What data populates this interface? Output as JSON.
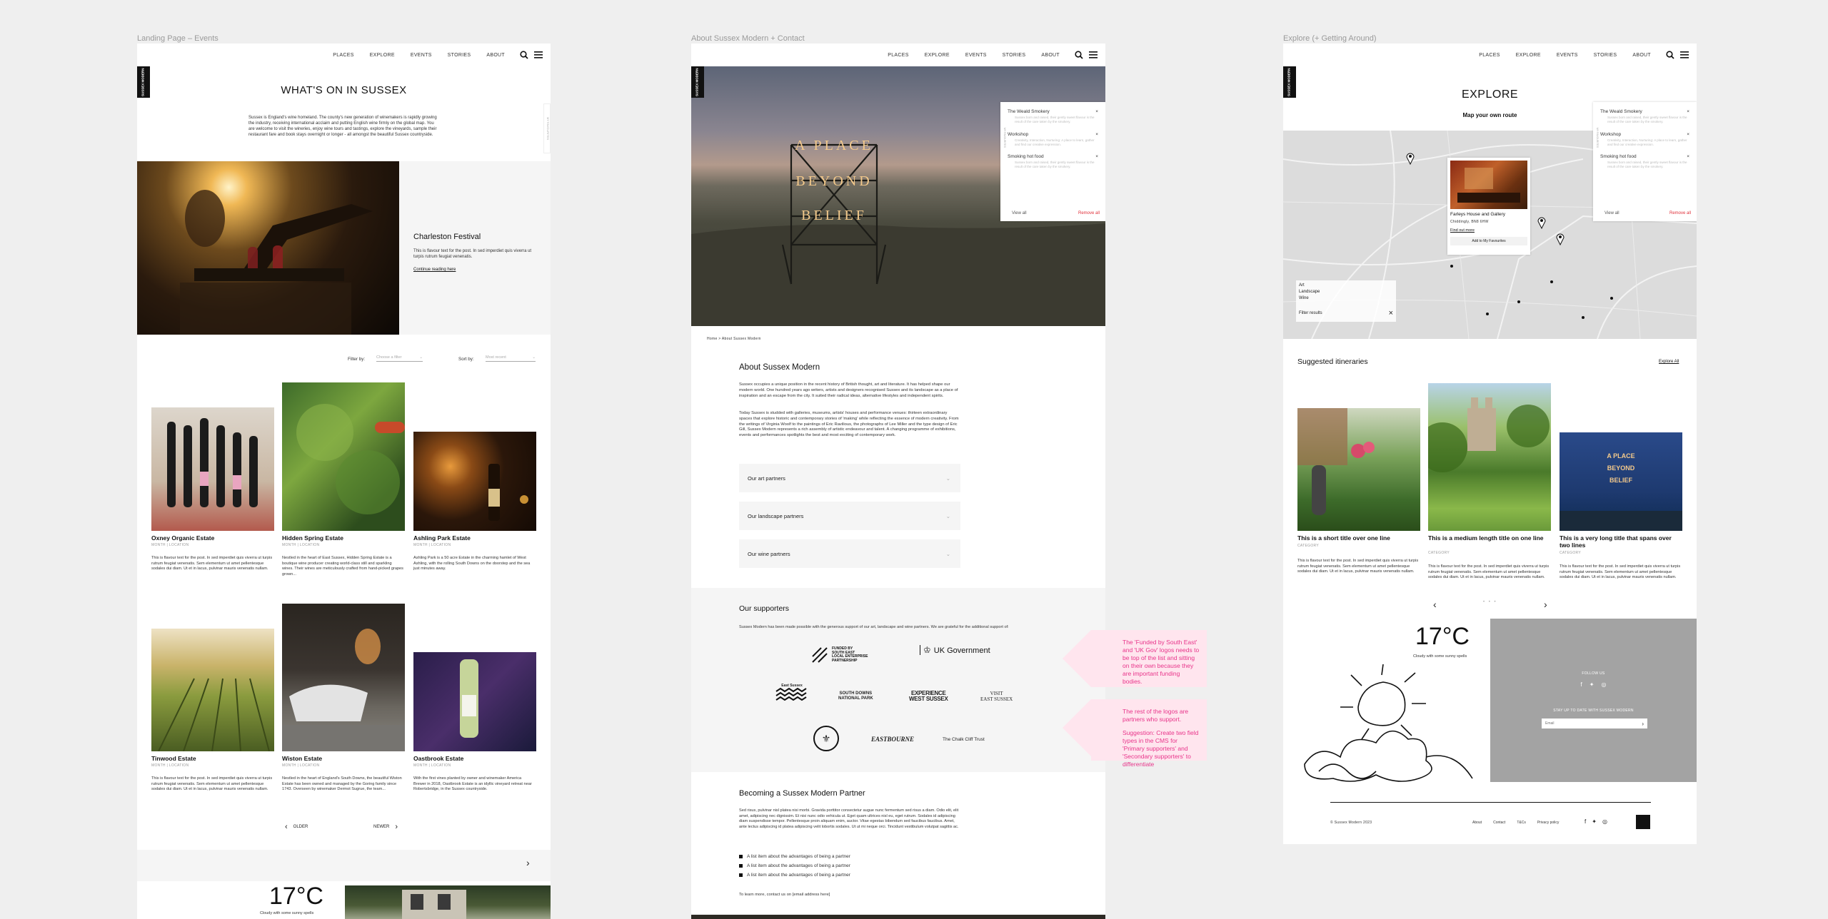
{
  "frames": {
    "events": "Landing Page – Events",
    "about": "About Sussex Modern + Contact",
    "explore": "Explore (+ Getting Around)"
  },
  "nav": {
    "items": [
      "PLACES",
      "EXPLORE",
      "EVENTS",
      "STORIES",
      "ABOUT"
    ],
    "logo": "SUSSEX MODERN"
  },
  "events": {
    "title": "WHAT'S ON IN SUSSEX",
    "intro": "Sussex is England's wine homeland. The county's new generation of winemakers is rapidly growing the industry, receiving international acclaim and putting English wine firmly on the global map. You are welcome to visit the wineries, enjoy wine tours and tastings, explore the vineyards, sample their restaurant fare and book stays overnight or longer - all amongst the beautiful Sussex countryside.",
    "side_tab": "MY FAVOURITES",
    "feature": {
      "title": "Charleston Festival",
      "text": "This is flavour text for the post. In sed imperdiet quis viverra ut turpis rutrum feugiat venenatis.",
      "link": "Continue reading here"
    },
    "filter_label": "Filter by:",
    "filter_value": "Choose a filter",
    "sort_label": "Sort by:",
    "sort_value": "Most recent",
    "cards": [
      {
        "title": "Oxney Organic Estate",
        "meta": "MONTH  |  LOCATION",
        "text": "This is flavour text for the post. In sed imperdiet quis viverra ut turpis rutrum feugiat venenatis. Sem elementum ut amet pellentesque sodales dui diam. Ut et in lacus, pulvinar mauris venenatis nullam."
      },
      {
        "title": "Hidden Spring Estate",
        "meta": "MONTH  |  LOCATION",
        "text": "Nestled in the heart of East Sussex, Hidden Spring Estate is a boutique wine producer creating world-class still and sparkling wines. Their wines are meticulously crafted from hand-picked grapes grown..."
      },
      {
        "title": "Ashling Park Estate",
        "meta": "MONTH  |  LOCATION",
        "text": "Ashling Park is a 50 acre Estate in the charming hamlet of West Ashling, with the rolling South Downs on the doorstep and the sea just minutes away."
      },
      {
        "title": "Tinwood Estate",
        "meta": "MONTH  |  LOCATION",
        "text": "This is flavour text for the post. In sed imperdiet quis viverra ut turpis rutrum feugiat venenatis. Sem elementum ut amet pellentesque sodales dui diam. Ut et in lacus, pulvinar mauris venenatis nullam."
      },
      {
        "title": "Wiston Estate",
        "meta": "MONTH  |  LOCATION",
        "text": "Nestled in the heart of England's South Downs, the beautiful Wiston Estate has been owned and managed by the Goring family since 1743. Overseen by winemaker Dermot Sugrue, the team..."
      },
      {
        "title": "Oastbrook Estate",
        "meta": "MONTH  |  LOCATION",
        "text": "With the first vines planted by owner and winemaker America Brewer in 2018, Oastbrook Estate is an idyllic vineyard retreat near Robertsbridge, in the Sussex countryside."
      }
    ],
    "older": "OLDER",
    "newer": "NEWER",
    "temp": "17°C",
    "weather": "Cloudy with some sunny spells"
  },
  "about": {
    "sign": [
      "A PLACE",
      "BEYOND",
      "BELIEF"
    ],
    "breadcrumb": "Home  >  About Sussex Modern",
    "title": "About Sussex Modern",
    "p1": "Sussex occupies a unique position in the recent history of British thought, art and literature. It has helped shape our modern world. One hundred years ago writers, artists and designers recognised Sussex and its landscape as a place of inspiration and an escape from the city. It suited their radical ideas, alternative lifestyles and independent spirits.",
    "p2": "Today Sussex is studded with galleries, museums, artists' houses and performance venues: thirteen extraordinary spaces that explore historic and contemporary stories of 'making' while reflecting the essence of modern creativity. From the writings of Virginia Woolf to the paintings of Eric Ravilious, the photographs of Lee Miller and the type design of Eric Gill, Sussex Modern represents a rich assembly of artistic endeavour and talent. A changing programme of exhibitions, events and performances spotlights the best and most exciting of contemporary work.",
    "accordions": [
      "Our art partners",
      "Our landscape partners",
      "Our wine partners"
    ],
    "supporters_title": "Our supporters",
    "supporters_text": "Sussex Modern has been made possible with the generous support of our art, landscape and wine partners. We are grateful for the additional support of:",
    "logos": {
      "funded": "FUNDED BY\nSOUTH EAST\nLOCAL ENTERPRISE\nPARTNERSHIP",
      "ukgov": "UK Government",
      "eastsussex": "East Sussex",
      "southdowns": "SOUTH DOWNS\nNATIONAL PARK",
      "experience": "EXPERIENCE\nWEST SUSSEX",
      "visitess": "VISIT\nEAST SUSSEX",
      "eastbourne": "EASTBOURNE",
      "cliff": "The Chalk Cliff Trust"
    },
    "note1": "The 'Funded by South East' and 'UK Gov' logos needs to be top of the list and sitting on their own because they are important funding bodies.",
    "note2a": "The rest of the logos are partners who support.",
    "note2b": "Suggestion: Create two field types in the CMS for 'Primary supporters' and 'Secondary supporters' to differentiate",
    "partner_title": "Becoming a Sussex Modern Partner",
    "partner_text": "Sed risus, pulvinar nisl platea nisi morbi. Gravida porttitor consectetur augue nunc fermentum sed risus a diam. Odio elit, elit amet, adipiscing nec dignissim. Et nisi nunc odio vehicula ut. Eget quam ultrices nisl eu, eget rutrum. Sodales id adipiscing diam suspendisse tempor. Pellentesque proin aliquam enim, auctor. Vitae egestas bibendum sed faucibus faucibus. Amet, ante lectus adipiscing id platea adipiscing velit lobortis sodales. Ut ut mi neque orci. Tincidunt vestibulum volutpat sagittis ac.",
    "bullets": [
      "A list item about the advantages of being a partner",
      "A list item about the advantages of being a partner",
      "A list item about the advantages of being a partner"
    ],
    "contact": "To learn more, contact us on [email address here]"
  },
  "favourites": {
    "tab": "MY FAVOURITES",
    "items": [
      {
        "title": "The Weald Smokery",
        "text": "Sussex born and raised, their gently sweet flavour is the result of the care taken by the smokery."
      },
      {
        "title": "Workshop",
        "text": "Creativity, Interaction, Nurturing: A place to learn, gather and find our creative expression."
      },
      {
        "title": "Smoking hot food",
        "text": "Sussex born and raised, their gently sweet flavour is the result of the care taken by the smokery."
      }
    ],
    "view_all": "View all",
    "remove_all": "Remove all"
  },
  "explore": {
    "title": "EXPLORE",
    "subtitle": "Map your own route",
    "popup_title": "Farleys House and Gallery",
    "popup_meta": "Chiddingly, BN8 6HW",
    "popup_link": "Find out more",
    "popup_btn": "Add to My Favourites",
    "filters": [
      "Art",
      "Landscape",
      "Wine"
    ],
    "filter_results": "Filter results",
    "itin_title": "Suggested itineraries",
    "explore_all": "Explore All",
    "itins": [
      {
        "title": "This is a short title over one line",
        "meta": "CATEGORY",
        "text": "This is flavour text for the post. In sed imperdiet quis viverra ut turpis rutrum feugiat venenatis. Sem elementum ut amet pellentesque sodales dui diam. Ut et in lacus, pulvinar mauris venenatis nullam."
      },
      {
        "title": "This is a medium length title on one line",
        "meta": "CATEGORY",
        "text": "This is flavour text for the post. In sed imperdiet quis viverra ut turpis rutrum feugiat venenatis. Sem elementum ut amet pellentesque sodales dui diam. Ut et in lacus, pulvinar mauris venenatis nullam."
      },
      {
        "title": "This is a very long title that spans over two lines",
        "meta": "CATEGORY",
        "text": "This is flavour text for the post. In sed imperdiet quis viverra ut turpis rutrum feugiat venenatis. Sem elementum ut amet pellentesque sodales dui diam. Ut et in lacus, pulvinar mauris venenatis nullam."
      }
    ],
    "temp": "17°C",
    "weather": "Cloudy with some sunny spells",
    "follow": "FOLLOW US",
    "newsletter": "STAY UP TO DATE WITH SUSSEX MODERN",
    "email_placeholder": "Email",
    "copyright": "© Sussex Modern 2023",
    "footer_links": [
      "About",
      "Contact",
      "T&Cs",
      "Privacy policy"
    ]
  }
}
